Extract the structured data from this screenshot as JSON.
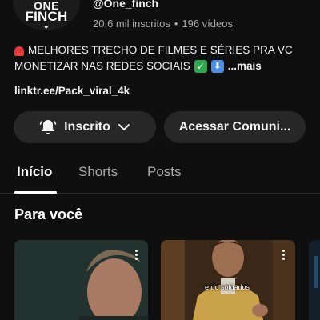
{
  "channel": {
    "avatar_line1": "ONE",
    "avatar_line2": "FINCH",
    "handle": "@One_finch",
    "subscribers": "20,6 mil inscritos",
    "separator": "•",
    "videos": "196 vídeos"
  },
  "description": {
    "line1": "MELHORES TRECHO DE FILMES E SÉRIES PRA VC",
    "line2": "MONETIZAR NAS REDES SOCIAIS",
    "more": "...mais"
  },
  "link": "linktr.ee/Pack_viral_4k",
  "buttons": {
    "subscribed": "Inscrito",
    "community": "Acessar Comuni..."
  },
  "tabs": [
    {
      "label": "Início",
      "active": true
    },
    {
      "label": "Shorts",
      "active": false
    },
    {
      "label": "Posts",
      "active": false
    }
  ],
  "section": {
    "title": "Para você"
  },
  "thumbnails": [
    {
      "caption": ""
    },
    {
      "caption": "e do soldados"
    },
    {
      "caption": ""
    }
  ],
  "icons": {
    "bell": "bell-icon",
    "chevron": "chevron-down-icon",
    "menu": "kebab-menu-icon"
  },
  "colors": {
    "background": "#0f0f0f",
    "button_bg": "#272727",
    "text_secondary": "#aaaaaa"
  }
}
